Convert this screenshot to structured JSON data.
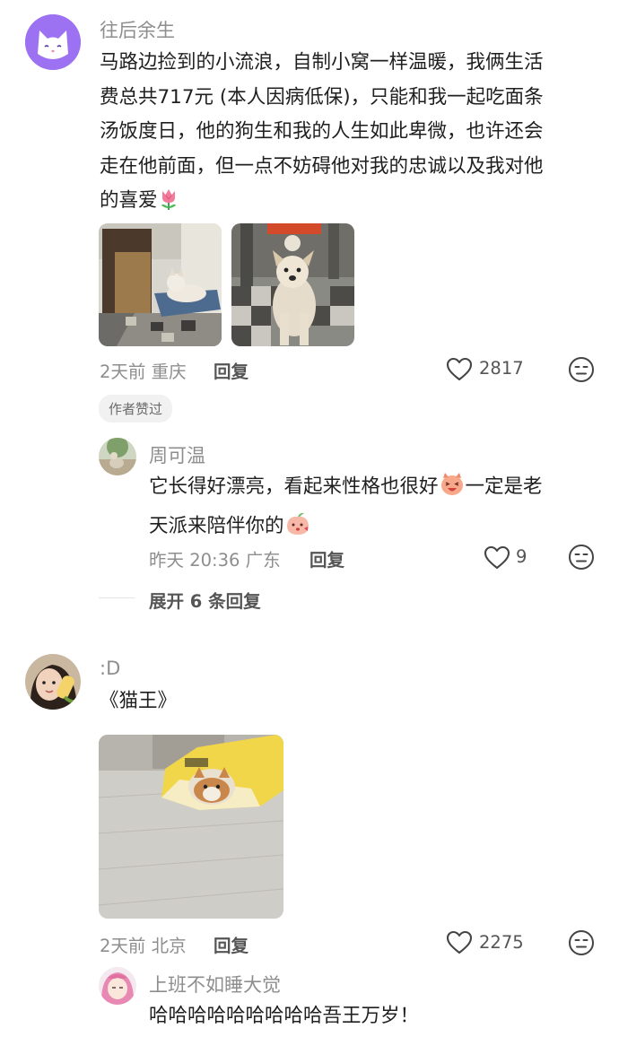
{
  "comments": [
    {
      "username": "往后余生",
      "text_line1": "马路边捡到的小流浪，自制小窝一样温暖，我俩生活",
      "text_line2": "费总共717元 (本人因病低保)，只能和我一起吃面条",
      "text_line3": "汤饭度日，他的狗生和我的人生如此卑微，也许还会",
      "text_line4": "走在他前面，但一点不妨碍他对我的忠诚以及我对他",
      "text_line5": "的喜爱",
      "time": "2天前",
      "location": "重庆",
      "reply_label": "回复",
      "likes": "2817",
      "badge": "作者赞过",
      "like_icon": "heart-outline-icon",
      "dislike_icon": "neutral-face-icon"
    },
    {
      "username": ":D",
      "text": "《猫王》",
      "time": "2天前",
      "location": "北京",
      "reply_label": "回复",
      "likes": "2275"
    }
  ],
  "reply": {
    "username": "周可温",
    "text_line1_a": "它长得好漂亮，看起来性格也很好",
    "text_line1_b": "一定是老",
    "text_line2": "天派来陪伴你的",
    "time": "昨天 20:36",
    "location": "广东",
    "reply_label": "回复",
    "likes": "9"
  },
  "expand_replies": "展开 6 条回复",
  "reply2": {
    "username": "上班不如睡大觉",
    "text": "哈哈哈哈哈哈哈哈哈吾王万岁！"
  },
  "colors": {
    "text": "#1f1f1f",
    "secondary": "#8e8e8e",
    "avatar_purple": "#9b6cf0"
  }
}
